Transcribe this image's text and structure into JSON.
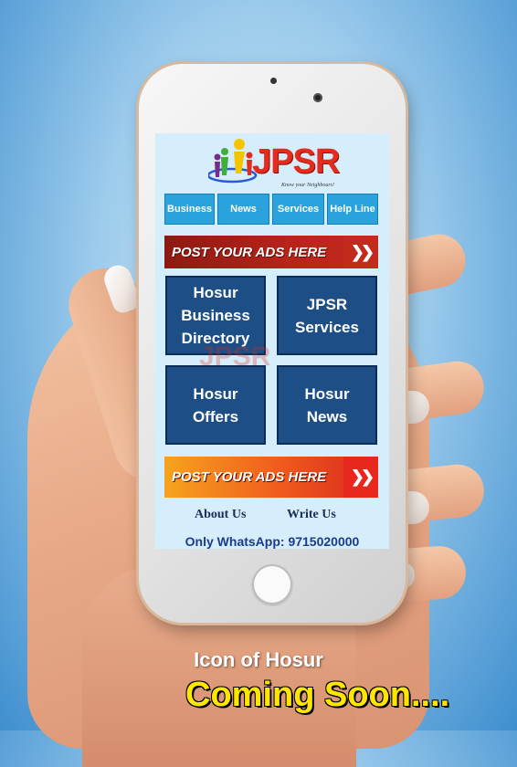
{
  "app": {
    "logo_text": "JPSR",
    "tagline": "Know your Neighbours!",
    "watermark": "JPSR"
  },
  "nav": {
    "items": [
      {
        "label": "Business"
      },
      {
        "label": "News"
      },
      {
        "label": "Services"
      },
      {
        "label": "Help Line"
      }
    ]
  },
  "banners": {
    "top": {
      "text": "POST YOUR ADS HERE"
    },
    "bottom": {
      "text": "POST YOUR ADS HERE"
    }
  },
  "tiles": [
    {
      "line1": "Hosur",
      "line2": "Business",
      "line3": "Directory"
    },
    {
      "line1": "JPSR",
      "line2": "Services"
    },
    {
      "line1": "Hosur",
      "line2": "Offers"
    },
    {
      "line1": "Hosur",
      "line2": "News"
    }
  ],
  "footer_links": {
    "about": "About Us",
    "write": "Write Us"
  },
  "contact": {
    "whatsapp": "Only WhatsApp: 9715020000"
  },
  "captions": {
    "tagline": "Icon of Hosur",
    "announcement": "Coming Soon...."
  },
  "colors": {
    "nav_blue": "#2aa3dc",
    "tile_blue": "#1d4e86",
    "logo_red": "#e52b1e",
    "caption_yellow": "#ffe600"
  }
}
